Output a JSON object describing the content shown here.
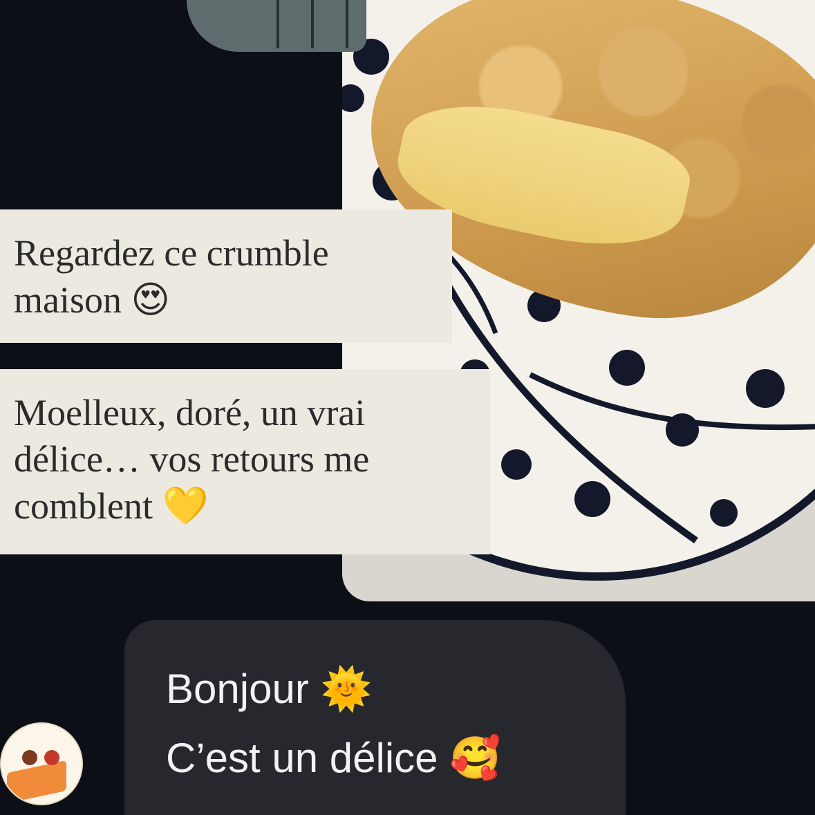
{
  "captions": [
    {
      "lines": [
        "Regardez ce crumble",
        "maison"
      ],
      "emoji": "😍"
    },
    {
      "lines": [
        "Moelleux, doré, un vrai",
        "délice… vos retours me",
        "comblent"
      ],
      "emoji": "💛"
    }
  ],
  "chat": {
    "lines": [
      {
        "text": "Bonjour",
        "emoji": "🌞"
      },
      {
        "text": "C’est un délice",
        "emoji": "🥰"
      }
    ]
  },
  "colors": {
    "background": "#0c0f15",
    "caption_bg": "#ece9e1",
    "bubble_bg": "#26282d",
    "plate_pattern": "#14182b"
  }
}
